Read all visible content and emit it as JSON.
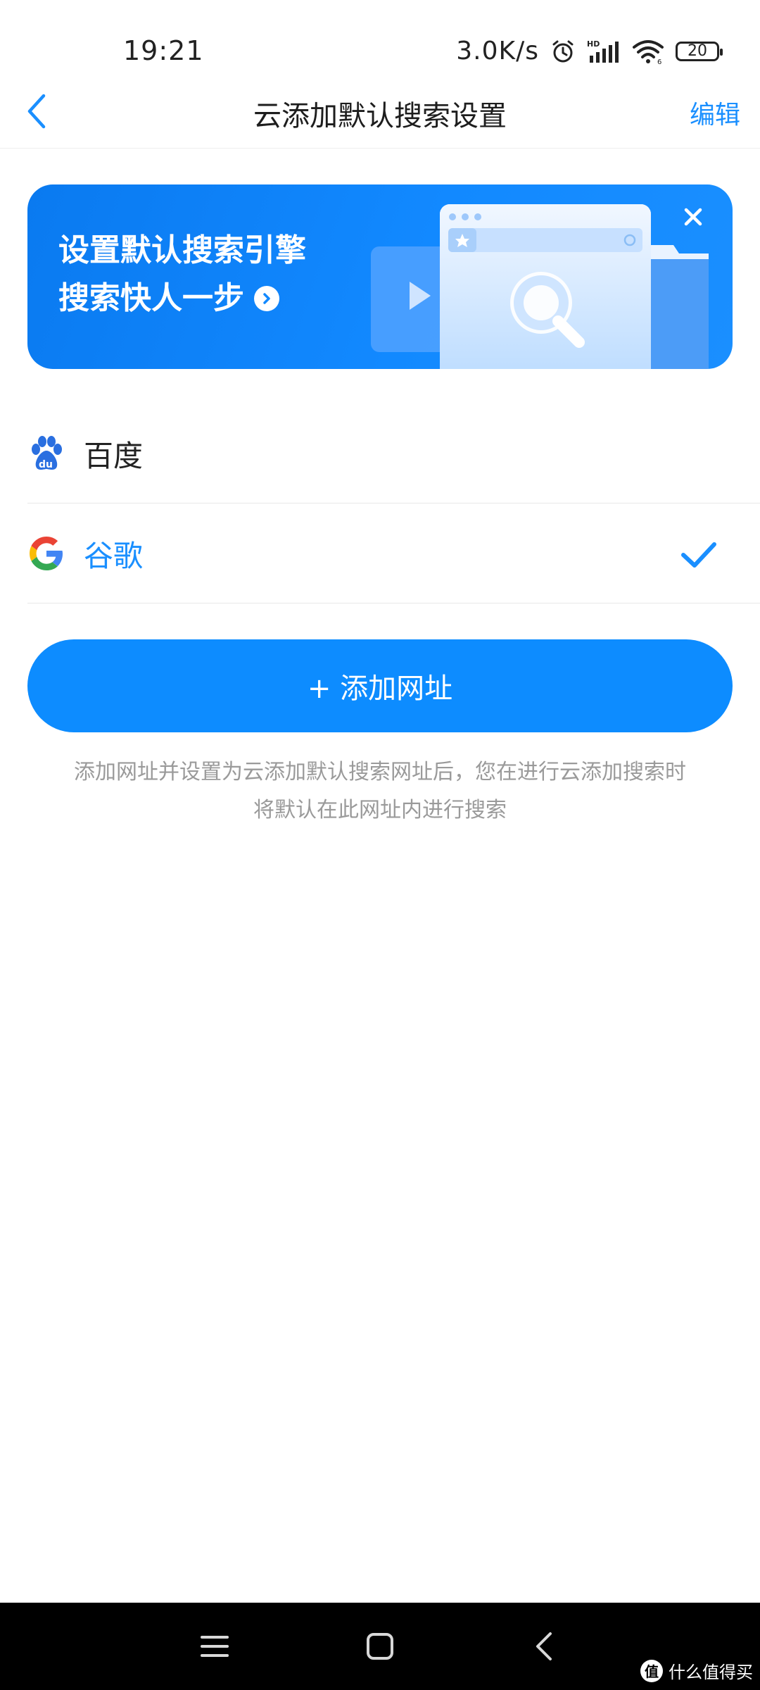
{
  "status_bar": {
    "time": "19:21",
    "network_speed": "3.0K/s",
    "battery": "20",
    "icons": [
      "alarm-icon",
      "hd-signal-icon",
      "wifi-icon",
      "battery-icon"
    ]
  },
  "nav": {
    "title": "云添加默认搜索设置",
    "edit_label": "编辑",
    "back_icon": "chevron-left-icon"
  },
  "banner": {
    "line1": "设置默认搜索引擎",
    "line2": "搜索快人一步",
    "close_icon": "close-icon",
    "arrow_icon": "chevron-right-circle-icon"
  },
  "engines": [
    {
      "label": "百度",
      "icon": "baidu-icon",
      "selected": false
    },
    {
      "label": "谷歌",
      "icon": "google-icon",
      "selected": true
    }
  ],
  "add_button": {
    "label": "+ 添加网址"
  },
  "hint": {
    "line1": "添加网址并设置为云添加默认搜索网址后，您在进行云添加搜索时",
    "line2": "将默认在此网址内进行搜索"
  },
  "system_nav": {
    "icons": [
      "menu-icon",
      "home-icon",
      "back-icon"
    ]
  },
  "watermark": {
    "badge": "值",
    "text": "什么值得买"
  },
  "colors": {
    "accent": "#1a8fff",
    "banner": "#1289ff",
    "hint": "#9a9a9a"
  }
}
